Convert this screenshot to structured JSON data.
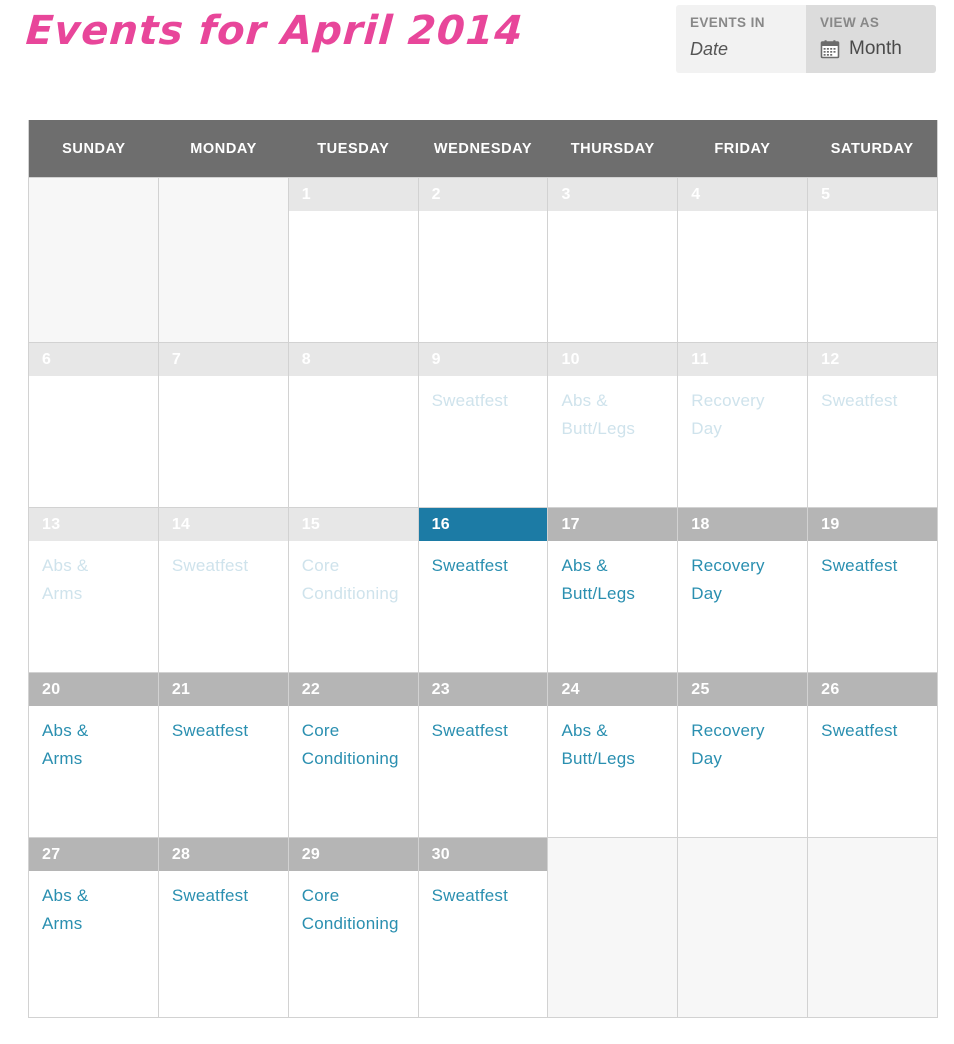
{
  "header": {
    "title": "Events for April 2014",
    "title_color": "#e8469a",
    "controls": [
      {
        "label": "EVENTS IN",
        "value": "Date",
        "icon": null,
        "selected": false
      },
      {
        "label": "VIEW AS",
        "value": "Month",
        "icon": "calendar-icon",
        "selected": true
      }
    ]
  },
  "calendar": {
    "month": "April",
    "year": "2014",
    "today": 16,
    "accent_color": "#1c7ba5",
    "event_color": "#2a8fb0",
    "event_faded_color": "#cfe3ec",
    "header_bg": "#6e6e6e",
    "daynum_past_bg": "#e7e7e7",
    "daynum_future_bg": "#b5b5b5",
    "weekday_headers": [
      "SUNDAY",
      "MONDAY",
      "TUESDAY",
      "WEDNESDAY",
      "THURSDAY",
      "FRIDAY",
      "SATURDAY"
    ],
    "weeks": [
      [
        {
          "day": null,
          "state": "blank",
          "events": []
        },
        {
          "day": null,
          "state": "blank",
          "events": []
        },
        {
          "day": "1",
          "state": "past",
          "events": []
        },
        {
          "day": "2",
          "state": "past",
          "events": []
        },
        {
          "day": "3",
          "state": "past",
          "events": []
        },
        {
          "day": "4",
          "state": "past",
          "events": []
        },
        {
          "day": "5",
          "state": "past",
          "events": []
        }
      ],
      [
        {
          "day": "6",
          "state": "past",
          "events": []
        },
        {
          "day": "7",
          "state": "past",
          "events": []
        },
        {
          "day": "8",
          "state": "past",
          "events": []
        },
        {
          "day": "9",
          "state": "past",
          "events": [
            "Sweatfest"
          ]
        },
        {
          "day": "10",
          "state": "past",
          "events": [
            "Abs & Butt/Legs"
          ]
        },
        {
          "day": "11",
          "state": "past",
          "events": [
            "Recovery Day"
          ]
        },
        {
          "day": "12",
          "state": "past",
          "events": [
            "Sweatfest"
          ]
        }
      ],
      [
        {
          "day": "13",
          "state": "past",
          "events": [
            "Abs & Arms"
          ]
        },
        {
          "day": "14",
          "state": "past",
          "events": [
            "Sweatfest"
          ]
        },
        {
          "day": "15",
          "state": "past",
          "events": [
            "Core Conditioning"
          ]
        },
        {
          "day": "16",
          "state": "today",
          "events": [
            "Sweatfest"
          ]
        },
        {
          "day": "17",
          "state": "future",
          "events": [
            "Abs & Butt/Legs"
          ]
        },
        {
          "day": "18",
          "state": "future",
          "events": [
            "Recovery Day"
          ]
        },
        {
          "day": "19",
          "state": "future",
          "events": [
            "Sweatfest"
          ]
        }
      ],
      [
        {
          "day": "20",
          "state": "future",
          "events": [
            "Abs & Arms"
          ]
        },
        {
          "day": "21",
          "state": "future",
          "events": [
            "Sweatfest"
          ]
        },
        {
          "day": "22",
          "state": "future",
          "events": [
            "Core Conditioning"
          ]
        },
        {
          "day": "23",
          "state": "future",
          "events": [
            "Sweatfest"
          ]
        },
        {
          "day": "24",
          "state": "future",
          "events": [
            "Abs & Butt/Legs"
          ]
        },
        {
          "day": "25",
          "state": "future",
          "events": [
            "Recovery Day"
          ]
        },
        {
          "day": "26",
          "state": "future",
          "events": [
            "Sweatfest"
          ]
        }
      ],
      [
        {
          "day": "27",
          "state": "future",
          "events": [
            "Abs & Arms"
          ]
        },
        {
          "day": "28",
          "state": "future",
          "events": [
            "Sweatfest"
          ]
        },
        {
          "day": "29",
          "state": "future",
          "events": [
            "Core Conditioning"
          ]
        },
        {
          "day": "30",
          "state": "future",
          "events": [
            "Sweatfest"
          ]
        },
        {
          "day": null,
          "state": "blank",
          "events": []
        },
        {
          "day": null,
          "state": "blank",
          "events": []
        },
        {
          "day": null,
          "state": "blank",
          "events": []
        }
      ]
    ]
  }
}
